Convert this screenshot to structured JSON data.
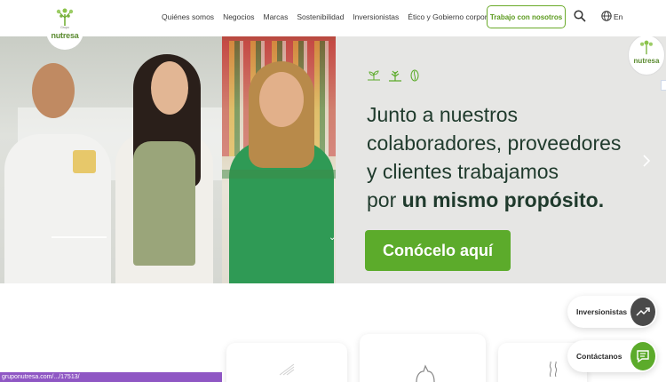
{
  "brand": {
    "logo_small": "Grupo",
    "logo_word": "nutresa",
    "accent": "#5cab2b",
    "text_dark": "#1f3a2c"
  },
  "nav": {
    "items": [
      {
        "label": "Quiénes somos"
      },
      {
        "label": "Negocios"
      },
      {
        "label": "Marcas"
      },
      {
        "label": "Sostenibilidad"
      },
      {
        "label": "Inversionistas"
      },
      {
        "label": "Ético y Gobierno corporativo"
      }
    ],
    "cta_label": "Trabajo con nosotros",
    "language": "En"
  },
  "hero": {
    "text_line1": "Junto a nuestros",
    "text_line2": "colaboradores, proveedores",
    "text_line3": "y clientes trabajamos",
    "text_line4_pre": "por ",
    "text_line4_highlight": "un mismo propósito.",
    "button_label": "Conócelo aquí",
    "badge_word": "nutresa",
    "icons": [
      "sprout-icon",
      "plant-icon",
      "seed-icon"
    ]
  },
  "floating": {
    "investors_label": "Inversionistas",
    "contact_label": "Contáctanos"
  },
  "status_url": "gruponutresa.com/.../17513/"
}
